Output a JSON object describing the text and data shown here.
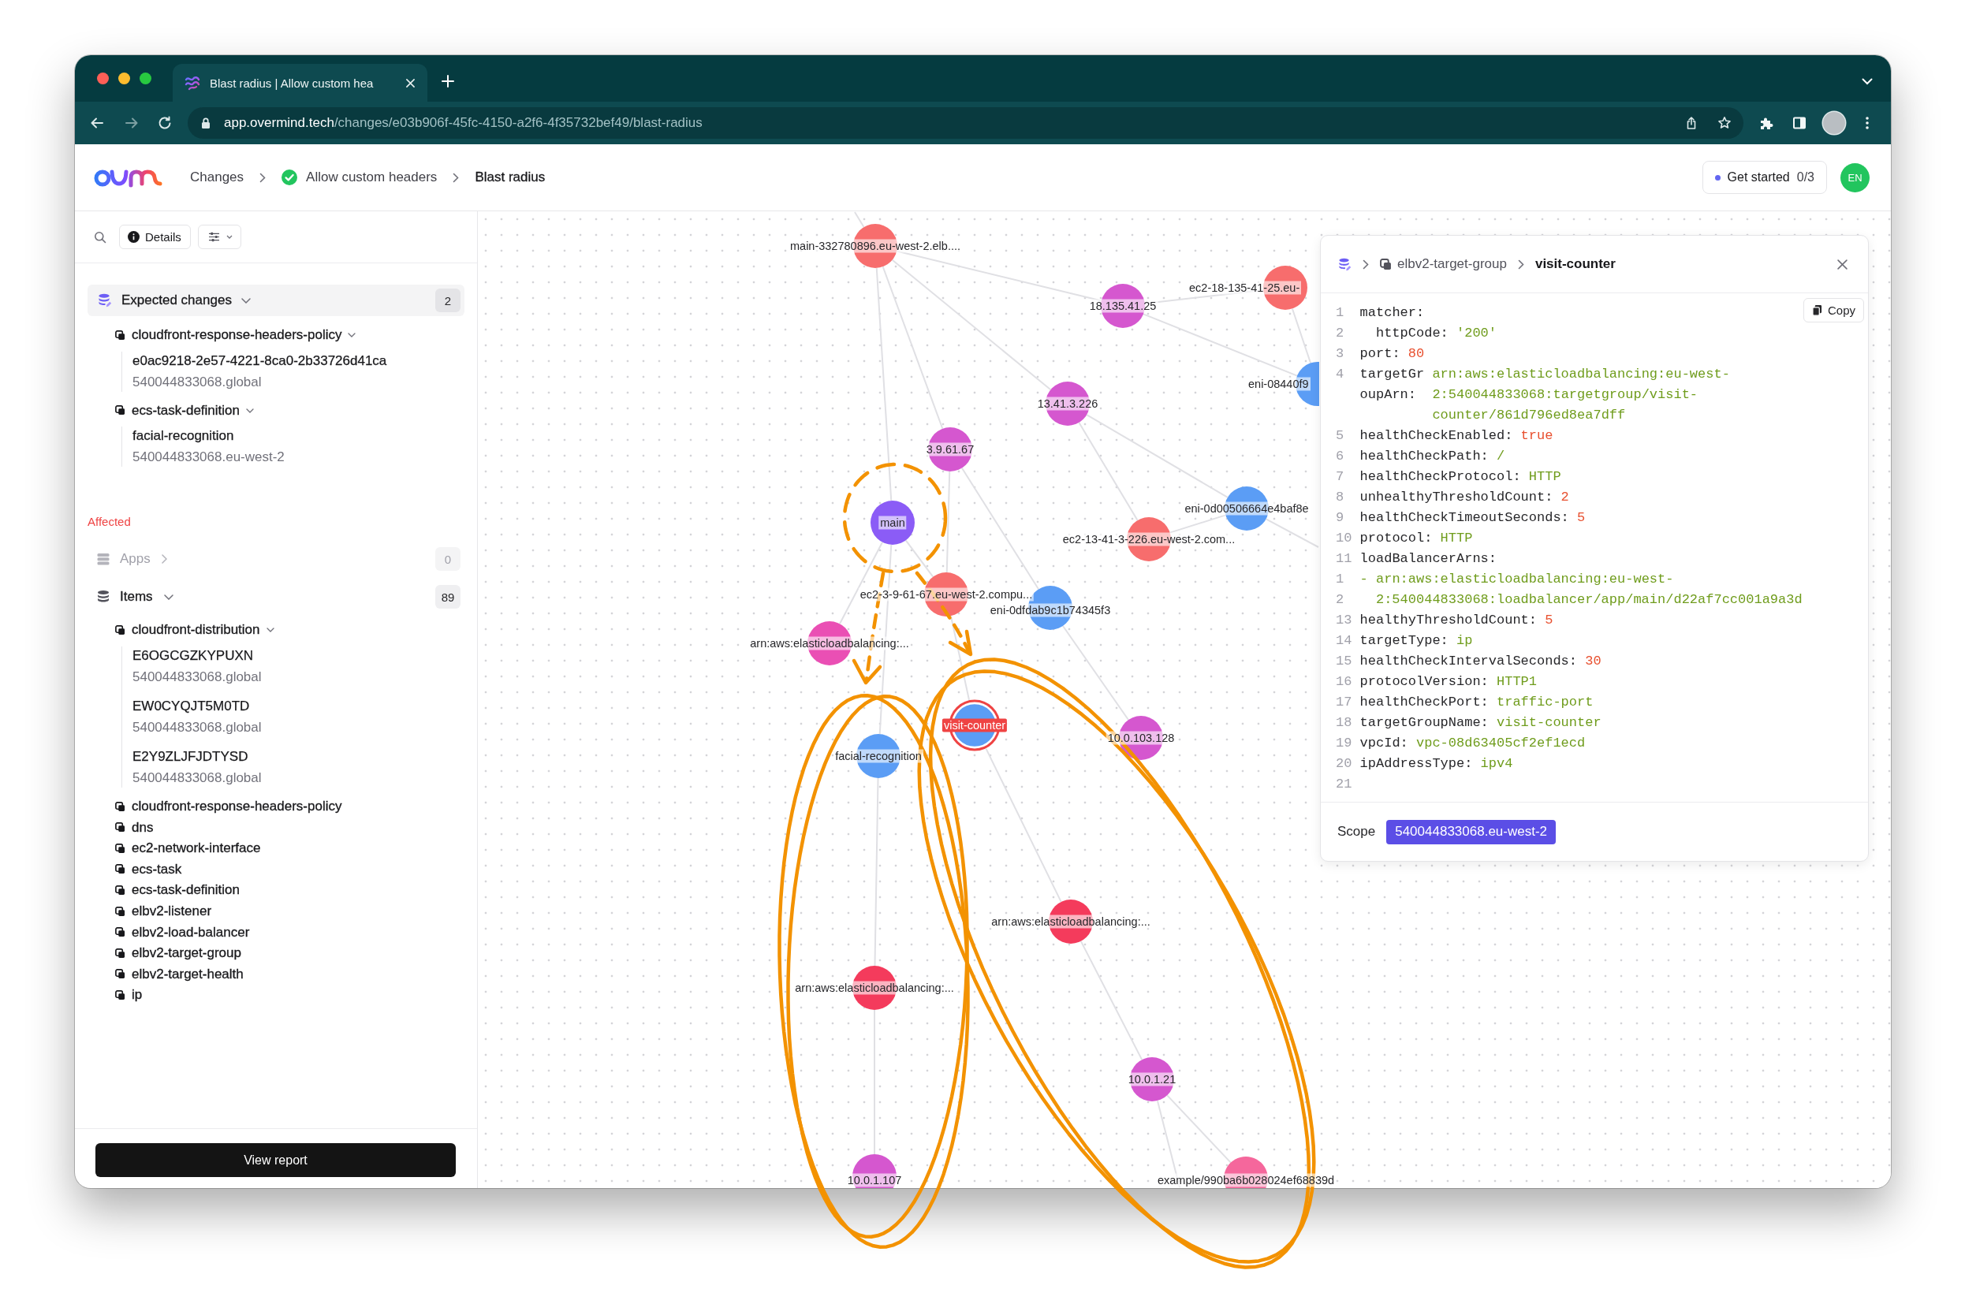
{
  "browser": {
    "tab_title": "Blast radius | Allow custom hea",
    "url": {
      "host": "app.overmind.tech",
      "path": "/changes/e03b906f-45fc-4150-a2f6-4f35732bef49/blast-radius"
    }
  },
  "header": {
    "breadcrumb": [
      {
        "label": "Changes",
        "kind": "link"
      },
      {
        "label": "Allow custom headers",
        "kind": "status"
      },
      {
        "label": "Blast radius",
        "kind": "current"
      }
    ],
    "get_started_button": {
      "label": "Get started",
      "progress": "0/3"
    },
    "avatar_initials": "EN"
  },
  "sidebar": {
    "details_button": "Details",
    "expected_changes": {
      "label": "Expected changes",
      "expanded": true,
      "count": "2",
      "groups": [
        {
          "type": "cloudfront-response-headers-policy",
          "expanded": true,
          "items": [
            {
              "name": "e0ac9218-2e57-4221-8ca0-2b33726d41ca",
              "scope": "540044833068.global"
            }
          ]
        },
        {
          "type": "ecs-task-definition",
          "expanded": true,
          "items": [
            {
              "name": "facial-recognition",
              "scope": "540044833068.eu-west-2"
            }
          ]
        }
      ]
    },
    "affected": {
      "heading": "Affected",
      "sections": [
        {
          "kind": "apps",
          "label": "Apps",
          "expanded": false,
          "disabled": true,
          "count": "0"
        },
        {
          "kind": "items",
          "label": "Items",
          "expanded": true,
          "disabled": false,
          "count": "89",
          "groups": [
            {
              "type": "cloudfront-distribution",
              "expanded": true,
              "items": [
                {
                  "name": "E6OGCGZKYPUXN",
                  "scope": "540044833068.global"
                },
                {
                  "name": "EW0CYQJT5M0TD",
                  "scope": "540044833068.global"
                },
                {
                  "name": "E2Y9ZLJFJDTYSD",
                  "scope": "540044833068.global"
                }
              ]
            },
            {
              "type": "cloudfront-response-headers-policy",
              "expanded": false
            },
            {
              "type": "dns",
              "expanded": false
            },
            {
              "type": "ec2-network-interface",
              "expanded": false
            },
            {
              "type": "ecs-task",
              "expanded": false
            },
            {
              "type": "ecs-task-definition",
              "expanded": false
            },
            {
              "type": "elbv2-listener",
              "expanded": false
            },
            {
              "type": "elbv2-load-balancer",
              "expanded": false
            },
            {
              "type": "elbv2-target-group",
              "expanded": false
            },
            {
              "type": "elbv2-target-health",
              "expanded": false
            },
            {
              "type": "ip",
              "expanded": false
            }
          ]
        }
      ]
    },
    "view_report_button": "View report"
  },
  "graph": {
    "nodes": [
      {
        "label": "main-332780896.eu-west-2.elb....",
        "color": "#f76d6d",
        "selected": false
      },
      {
        "label": "ec2-18-135-41-25.eu-",
        "color": "#f76d6d",
        "selected": false
      },
      {
        "label": "18.135.41.25",
        "color": "#d557cf",
        "selected": false
      },
      {
        "label": "eni-08440f9",
        "color": "#5b9df5",
        "selected": false
      },
      {
        "label": "13.41.3.226",
        "color": "#d557cf",
        "selected": false
      },
      {
        "label": "3.9.61.67",
        "color": "#d557cf",
        "selected": false
      },
      {
        "label": "eni-0d00506664e4baf8e",
        "color": "#5b9df5",
        "selected": false
      },
      {
        "label": "main",
        "color": "#8b5cf6",
        "selected": false
      },
      {
        "label": "ec2-13-41-3-226.eu-west-2.com...",
        "color": "#f76d6d",
        "selected": false
      },
      {
        "label": "ec2-3-9-61-67.eu-west-2.compu...",
        "color": "#f76d6d",
        "selected": false
      },
      {
        "label": "eni-0dfdab9c1b74345f3",
        "color": "#5b9df5",
        "selected": false
      },
      {
        "label": "arn:aws:elasticloadbalancing:...",
        "color": "#ea4fb4",
        "selected": false
      },
      {
        "label": "visit-counter",
        "color": "#5b9df5",
        "selected": true
      },
      {
        "label": "10.0.103.128",
        "color": "#d557cf",
        "selected": false
      },
      {
        "label": "facial-recognition",
        "color": "#5b9df5",
        "selected": false
      },
      {
        "label": "arn:aws:elasticloadbalancing:...",
        "color": "#f43b5c",
        "selected": false
      },
      {
        "label": "arn:aws:elasticloadbalancing:...",
        "color": "#f43b5c",
        "selected": false
      },
      {
        "label": "10.0.1.21",
        "color": "#d557cf",
        "selected": false
      },
      {
        "label": "10.0.1.107",
        "color": "#d557cf",
        "selected": false
      },
      {
        "label": "example/990ba6b028024ef68839d",
        "color": "#f5679c",
        "selected": false
      }
    ]
  },
  "details_panel": {
    "breadcrumb": {
      "type": "elbv2-target-group",
      "name": "visit-counter"
    },
    "copy_button": "Copy",
    "code_lines": [
      {
        "n": "1",
        "kind": "pair",
        "key": "matcher:"
      },
      {
        "n": "2",
        "kind": "nested",
        "key": "httpCode:",
        "value": {
          "kind": "string",
          "text": "'200'"
        }
      },
      {
        "n": "3",
        "kind": "pair",
        "key": "port:",
        "value": {
          "kind": "scalar",
          "text": "80"
        }
      },
      {
        "n": "4",
        "kind": "split",
        "key": "targetGr",
        "value": {
          "kind": "string",
          "text": "arn:aws:elasticloadbalancing:eu-west-"
        }
      },
      {
        "kind": "split",
        "key": "oupArn:",
        "value": {
          "kind": "string",
          "text": "2:540044833068:targetgroup/visit-"
        }
      },
      {
        "kind": "split",
        "value": {
          "kind": "string",
          "text": "counter/861d796ed8ea7dff"
        }
      },
      {
        "n": "5",
        "kind": "pair",
        "key": "healthCheckEnabled:",
        "value": {
          "kind": "scalar",
          "text": "true"
        }
      },
      {
        "n": "6",
        "kind": "pair",
        "key": "healthCheckPath:",
        "value": {
          "kind": "string",
          "text": "/"
        }
      },
      {
        "n": "7",
        "kind": "pair",
        "key": "healthCheckProtocol:",
        "value": {
          "kind": "string",
          "text": "HTTP"
        }
      },
      {
        "n": "8",
        "kind": "pair",
        "key": "unhealthyThresholdCount:",
        "value": {
          "kind": "scalar",
          "text": "2"
        }
      },
      {
        "n": "9",
        "kind": "pair",
        "key": "healthCheckTimeoutSeconds:",
        "value": {
          "kind": "scalar",
          "text": "5"
        }
      },
      {
        "n": "10",
        "kind": "pair",
        "key": "protocol:",
        "value": {
          "kind": "string",
          "text": "HTTP"
        }
      },
      {
        "n": "11",
        "kind": "pair",
        "key": "loadBalancerArns:"
      },
      {
        "n": "1",
        "kind": "pair",
        "value": {
          "kind": "string",
          "text": "- arn:aws:elasticloadbalancing:eu-west-"
        }
      },
      {
        "n": "2",
        "kind": "nested",
        "value": {
          "kind": "string",
          "text": "2:540044833068:loadbalancer/app/main/d22af7cc001a9a3d"
        }
      },
      {
        "n": "13",
        "kind": "pair",
        "key": "healthyThresholdCount:",
        "value": {
          "kind": "scalar",
          "text": "5"
        }
      },
      {
        "n": "14",
        "kind": "pair",
        "key": "targetType:",
        "value": {
          "kind": "string",
          "text": "ip"
        }
      },
      {
        "n": "15",
        "kind": "pair",
        "key": "healthCheckIntervalSeconds:",
        "value": {
          "kind": "scalar",
          "text": "30"
        }
      },
      {
        "n": "16",
        "kind": "pair",
        "key": "protocolVersion:",
        "value": {
          "kind": "string",
          "text": "HTTP1"
        }
      },
      {
        "n": "17",
        "kind": "pair",
        "key": "healthCheckPort:",
        "value": {
          "kind": "string",
          "text": "traffic-port"
        }
      },
      {
        "n": "18",
        "kind": "pair",
        "key": "targetGroupName:",
        "value": {
          "kind": "string",
          "text": "visit-counter"
        }
      },
      {
        "n": "19",
        "kind": "pair",
        "key": "vpcId:",
        "value": {
          "kind": "string",
          "text": "vpc-08d63405cf2ef1ecd"
        }
      },
      {
        "n": "20",
        "kind": "pair",
        "key": "ipAddressType:",
        "value": {
          "kind": "string",
          "text": "ipv4"
        }
      },
      {
        "n": "21"
      }
    ],
    "scope_label": "Scope",
    "scope": "540044833068.eu-west-2"
  },
  "annotations": [
    {
      "kind": "dashed_circle"
    },
    {
      "kind": "arrow"
    },
    {
      "kind": "arrow"
    },
    {
      "kind": "ellipse"
    },
    {
      "kind": "ellipse"
    }
  ]
}
